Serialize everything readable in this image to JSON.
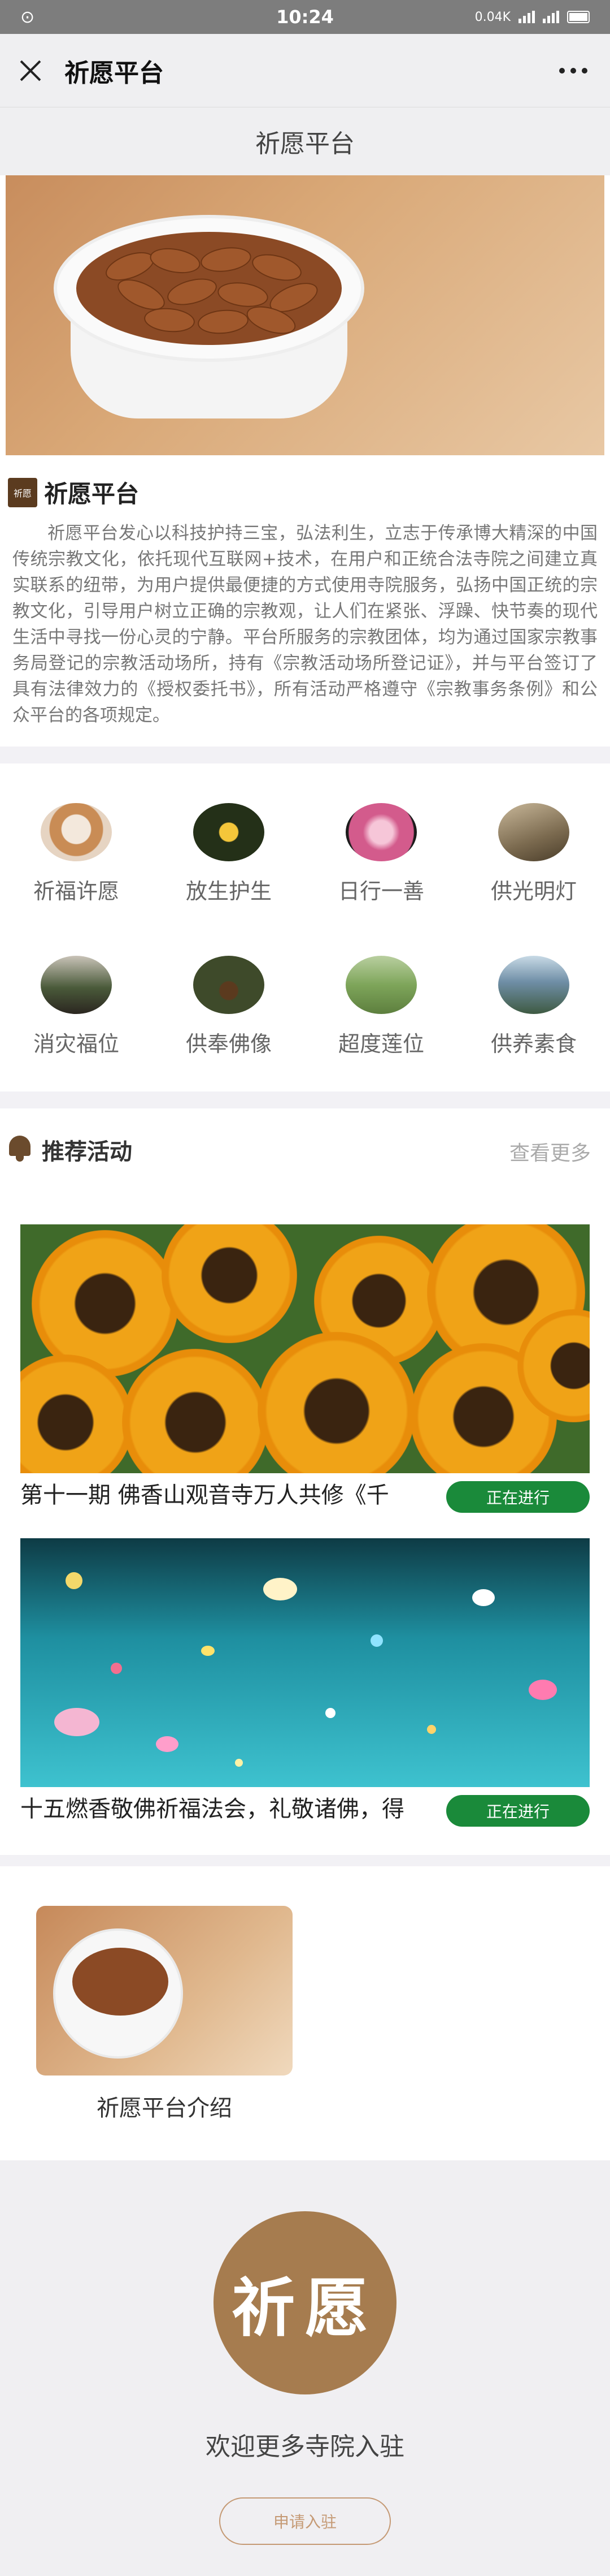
{
  "status_bar": {
    "time": "10:24",
    "speed": "0.04K"
  },
  "nav": {
    "title": "祈愿平台"
  },
  "page_header": {
    "title": "祈愿平台"
  },
  "intro": {
    "title": "祈愿平台",
    "logo_text": "祈愿",
    "text": "祈愿平台发心以科技护持三宝，弘法利生，立志于传承博大精深的中国传统宗教文化，依托现代互联网+技术，在用户和正统合法寺院之间建立真实联系的纽带，为用户提供最便捷的方式使用寺院服务，弘扬中国正统的宗教文化，引导用户树立正确的宗教观，让人们在紧张、浮躁、快节奏的现代生活中寻找一份心灵的宁静。平台所服务的宗教团体，均为通过国家宗教事务局登记的宗教活动场所，持有《宗教活动场所登记证》，并与平台签订了具有法律效力的《授权委托书》，所有活动严格遵守《宗教事务条例》和公众平台的各项规定。"
  },
  "services": [
    {
      "label": "祈福许愿",
      "icon": "fox-photo-icon",
      "color": "#c9a98a"
    },
    {
      "label": "放生护生",
      "icon": "flower-photo-icon",
      "color": "#2e3b1e"
    },
    {
      "label": "日行一善",
      "icon": "dahlia-photo-icon",
      "color": "#d35b8c"
    },
    {
      "label": "供光明灯",
      "icon": "bird-photo-icon",
      "color": "#7b6a4f"
    },
    {
      "label": "消灾福位",
      "icon": "plants-photo-icon",
      "color": "#4a5a3a"
    },
    {
      "label": "供奉佛像",
      "icon": "deer-photo-icon",
      "color": "#3e4a2a"
    },
    {
      "label": "超度莲位",
      "icon": "sheep-photo-icon",
      "color": "#7ea55a"
    },
    {
      "label": "供养素食",
      "icon": "mountain-photo-icon",
      "color": "#6f8ea6"
    }
  ],
  "activities": {
    "title": "推荐活动",
    "more": "查看更多",
    "items": [
      {
        "name": "第十一期 佛香山观音寺万人共修《千",
        "status": "正在进行"
      },
      {
        "name": "十五燃香敬佛祈福法会，礼敬诸佛，得",
        "status": "正在进行"
      }
    ]
  },
  "intro_link": {
    "caption": "祈愿平台介绍"
  },
  "footer": {
    "seal_text": "祈愿",
    "welcome": "欢迎更多寺院入驻",
    "apply_label": "申请入驻"
  },
  "colors": {
    "accent": "#a67c4f",
    "status_green": "#1a8a3a",
    "apply_border": "#c59a75"
  }
}
